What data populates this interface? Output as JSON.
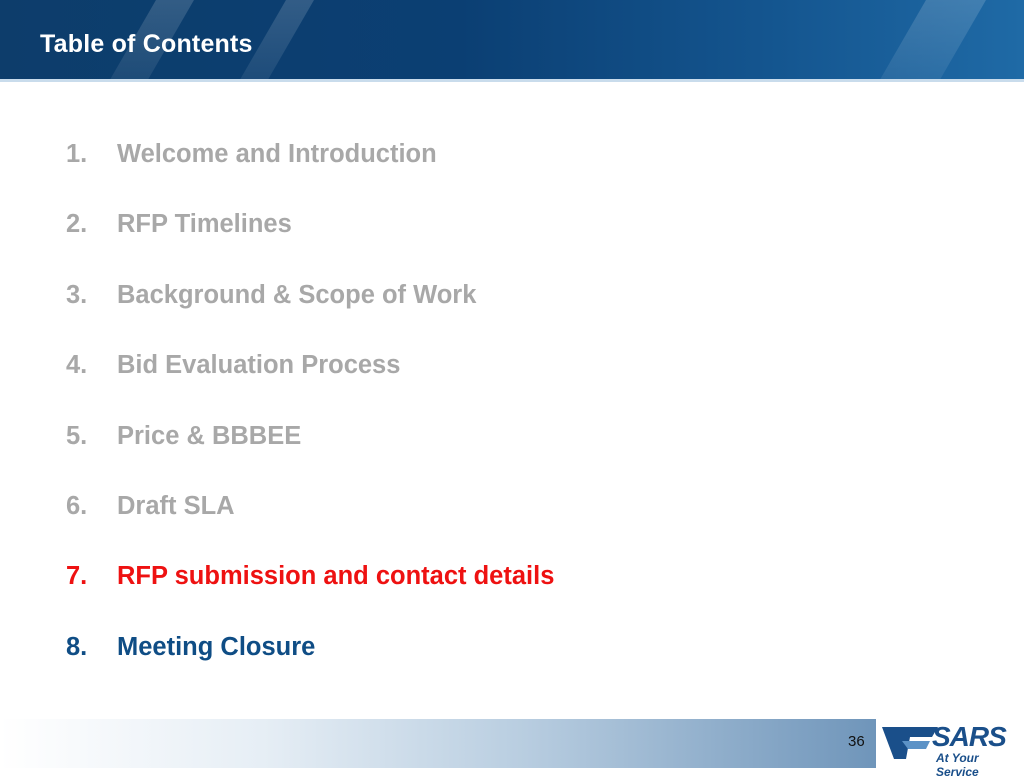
{
  "header": {
    "title": "Table of Contents"
  },
  "toc": {
    "items": [
      {
        "num": "1.",
        "label": "Welcome and Introduction",
        "state": "done"
      },
      {
        "num": "2.",
        "label": "RFP Timelines",
        "state": "done"
      },
      {
        "num": "3.",
        "label": "Background & Scope of Work",
        "state": "done"
      },
      {
        "num": "4.",
        "label": "Bid Evaluation Process",
        "state": "done"
      },
      {
        "num": "5.",
        "label": "Price & BBBEE",
        "state": "done"
      },
      {
        "num": "6.",
        "label": "Draft SLA",
        "state": "done"
      },
      {
        "num": "7.",
        "label": "RFP submission and contact details",
        "state": "current"
      },
      {
        "num": "8.",
        "label": "Meeting Closure",
        "state": "next"
      }
    ]
  },
  "footer": {
    "page_number": "36",
    "logo": {
      "name": "SARS",
      "tagline": "At Your Service"
    }
  },
  "colors": {
    "header": "#0d3d6b",
    "done_item": "#a8a8a8",
    "current_item": "#ee1111",
    "next_item": "#0f4d85",
    "logo": "#1a4f8a"
  }
}
